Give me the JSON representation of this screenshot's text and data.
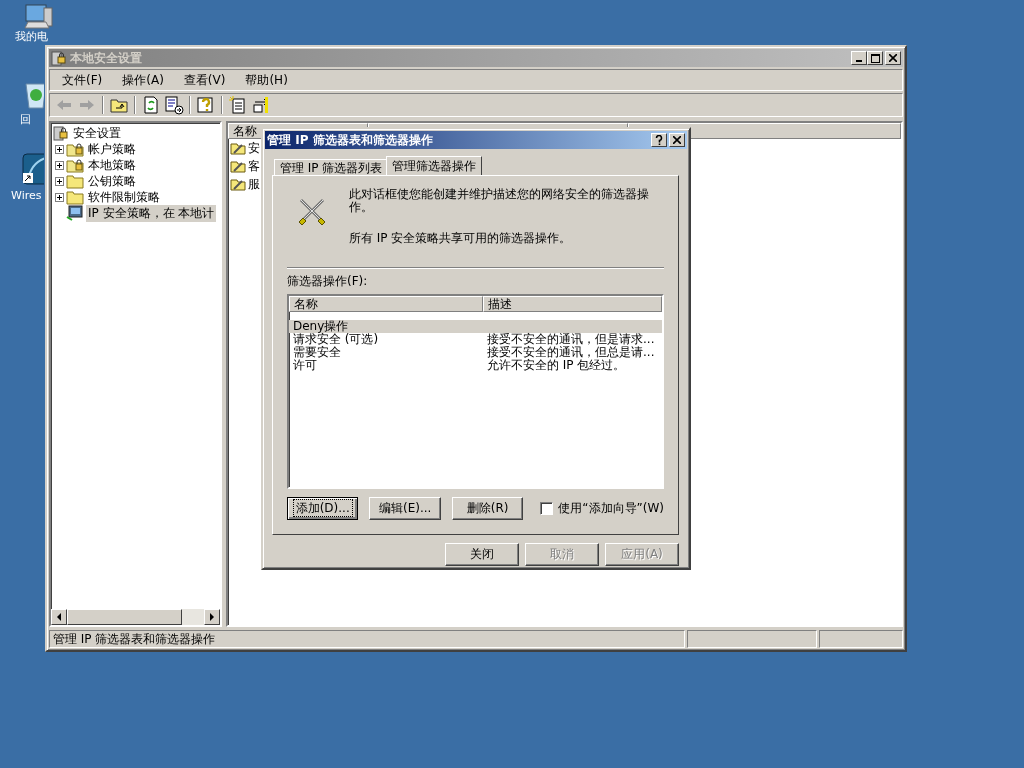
{
  "desktop_icons": [
    {
      "kind": "computer",
      "label": "我的电"
    },
    {
      "kind": "recycle",
      "label": "回"
    },
    {
      "kind": "shortcut",
      "label": "Wires"
    }
  ],
  "main_window": {
    "title": "本地安全设置",
    "menu": [
      "文件(F)",
      "操作(A)",
      "查看(V)",
      "帮助(H)"
    ],
    "tree": {
      "label": "安全设置",
      "children": [
        {
          "label": "帐户策略",
          "kind": "lock-folder",
          "expanded": false,
          "selected": false
        },
        {
          "label": "本地策略",
          "kind": "lock-folder",
          "expanded": false,
          "selected": false
        },
        {
          "label": "公钥策略",
          "kind": "folder",
          "expanded": false,
          "selected": false
        },
        {
          "label": "软件限制策略",
          "kind": "folder",
          "expanded": false,
          "selected": false
        },
        {
          "label": "IP 安全策略，在 本地计",
          "kind": "ip-policy",
          "selected": true
        }
      ]
    },
    "list": {
      "columns": [
        "名称"
      ],
      "rows": [
        "安",
        "客",
        "服"
      ]
    },
    "status_bar": [
      "管理 IP 筛选器表和筛选器操作"
    ]
  },
  "dialog": {
    "title": "管理 IP 筛选器表和筛选器操作",
    "tabs": [
      {
        "label": "管理 IP 筛选器列表",
        "selected": false
      },
      {
        "label": "管理筛选器操作",
        "selected": true
      }
    ],
    "description": "此对话框使您能创建并维护描述您的网络安全的筛选器操作。",
    "note": "所有 IP 安全策略共享可用的筛选器操作。",
    "list_label": "筛选器操作(F):",
    "columns": [
      "名称",
      "描述"
    ],
    "rows": [
      {
        "name": "Deny操作",
        "description": "",
        "selected": true
      },
      {
        "name": "请求安全 (可选)",
        "description": "接受不安全的通讯，但是请求...",
        "selected": false
      },
      {
        "name": "需要安全",
        "description": "接受不安全的通讯，但总是请...",
        "selected": false
      },
      {
        "name": "许可",
        "description": "允许不安全的 IP 包经过。",
        "selected": false
      }
    ],
    "buttons": [
      {
        "label": "添加(D)...",
        "focused": true
      },
      {
        "label": "编辑(E)...",
        "focused": false
      },
      {
        "label": "删除(R)",
        "focused": false
      }
    ],
    "wizard_checkbox": {
      "label": "使用“添加向导”(W)",
      "checked": false
    },
    "footer_buttons": [
      {
        "label": "关闭",
        "disabled": false
      },
      {
        "label": "取消",
        "disabled": true
      },
      {
        "label": "应用(A)",
        "disabled": true
      }
    ]
  }
}
